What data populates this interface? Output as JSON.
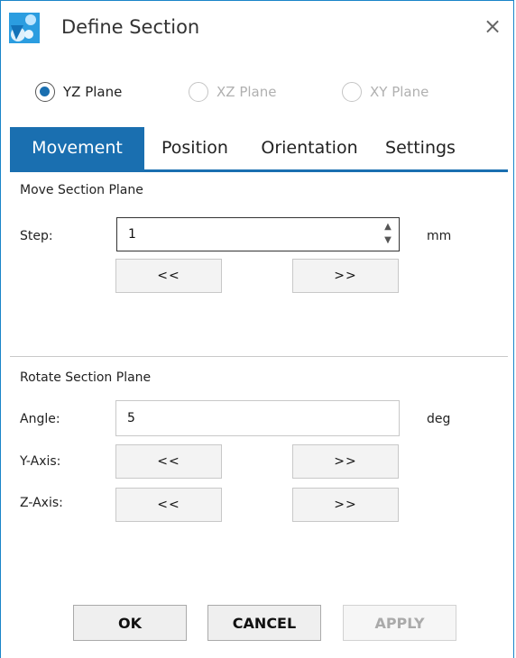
{
  "window": {
    "title": "Define Section",
    "close_symbol": "×"
  },
  "plane_options": [
    {
      "label": "YZ Plane",
      "selected": true,
      "enabled": true
    },
    {
      "label": "XZ Plane",
      "selected": false,
      "enabled": false
    },
    {
      "label": "XY Plane",
      "selected": false,
      "enabled": false
    }
  ],
  "tabs": [
    {
      "label": "Movement",
      "active": true
    },
    {
      "label": "Position",
      "active": false
    },
    {
      "label": "Orientation",
      "active": false
    },
    {
      "label": "Settings",
      "active": false
    }
  ],
  "move": {
    "heading": "Move Section Plane",
    "step_label": "Step:",
    "step_value": "1",
    "step_unit": "mm",
    "back_label": "<<",
    "forward_label": ">>"
  },
  "rotate": {
    "heading": "Rotate Section Plane",
    "angle_label": "Angle:",
    "angle_value": "5",
    "angle_unit": "deg",
    "y_axis_label": "Y-Axis:",
    "z_axis_label": "Z-Axis:",
    "back_label": "<<",
    "forward_label": ">>"
  },
  "footer": {
    "ok_label": "OK",
    "cancel_label": "CANCEL",
    "apply_label": "APPLY",
    "apply_enabled": false
  },
  "colors": {
    "accent": "#1a6fb0",
    "border": "#1a85c9"
  }
}
